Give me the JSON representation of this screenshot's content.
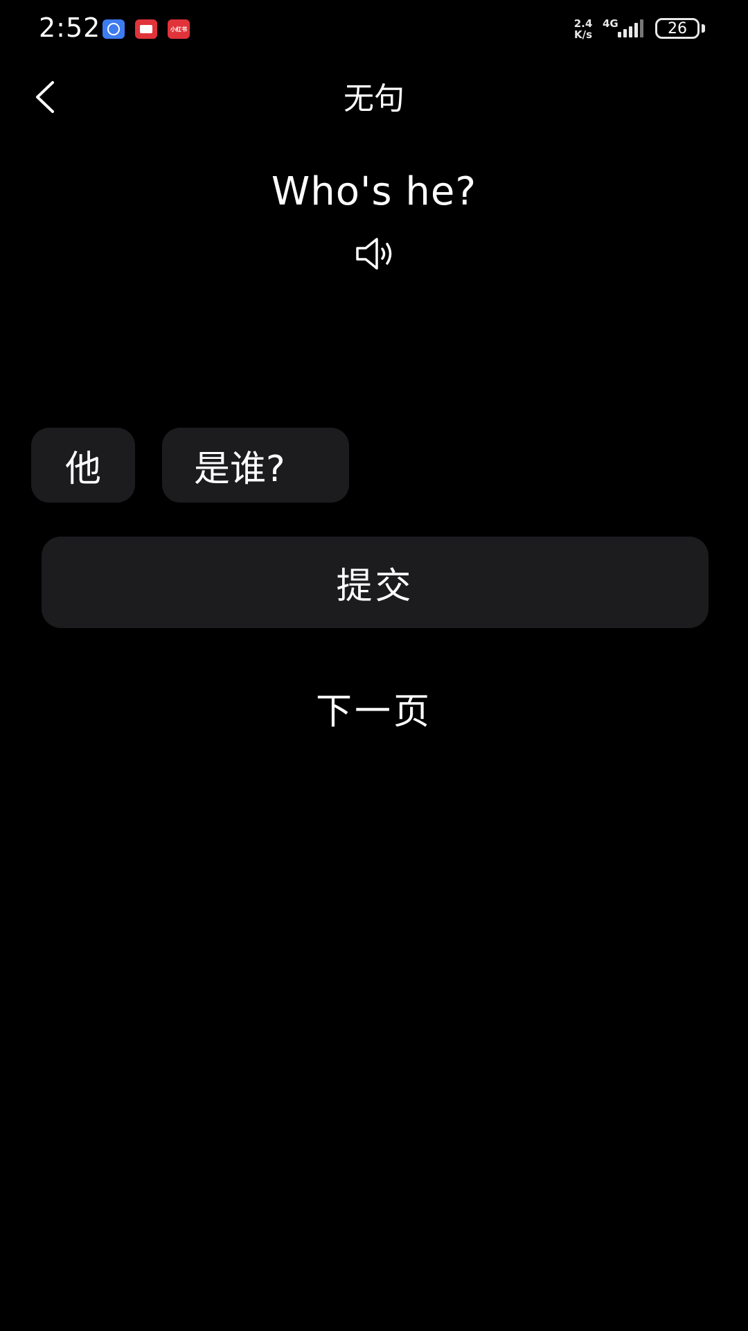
{
  "status_bar": {
    "time": "2:52",
    "net_speed_value": "2.4",
    "net_speed_unit": "K/s",
    "network_type": "4G",
    "battery_level": "26",
    "notification_icons": [
      "alarm-app-icon",
      "reader-app-icon",
      "xiaohongshu-app-icon"
    ],
    "xiaohongshu_label": "小红书"
  },
  "header": {
    "title": "无句",
    "back_icon": "chevron-left-icon"
  },
  "sentence": {
    "text": "Who's he?",
    "audio_icon": "speaker-icon"
  },
  "word_chips": [
    {
      "label": "他"
    },
    {
      "label": "是谁?"
    }
  ],
  "actions": {
    "submit_label": "提交",
    "next_page_label": "下一页"
  },
  "colors": {
    "background": "#000000",
    "surface": "#1c1c1f",
    "text": "#ffffff",
    "alarm_icon": "#3d7bf0",
    "red_icon": "#e0333a"
  }
}
